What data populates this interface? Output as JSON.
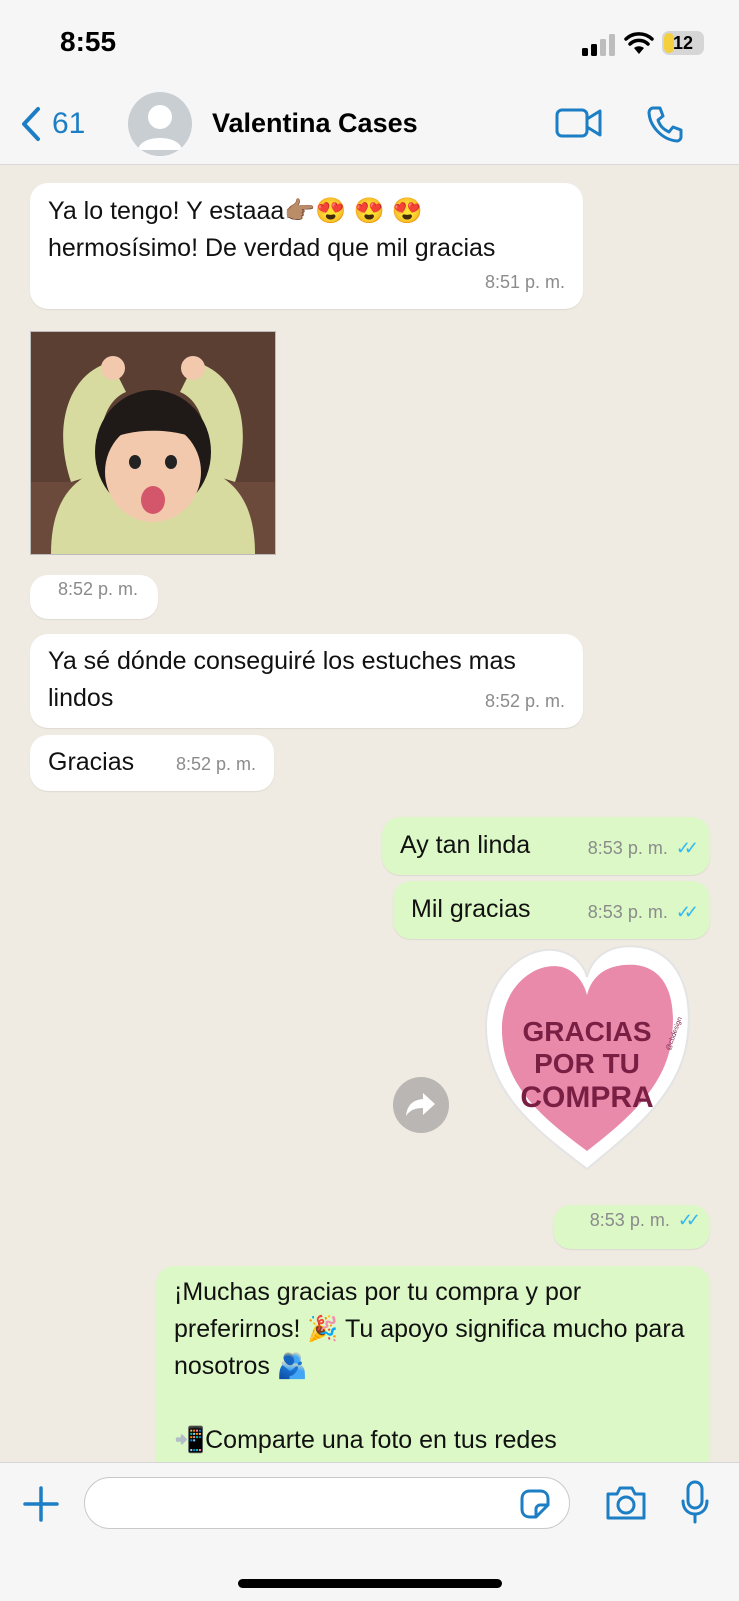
{
  "status_bar": {
    "time": "8:55",
    "battery": "12"
  },
  "header": {
    "back_count": "61",
    "contact_name": "Valentina Cases"
  },
  "messages": [
    {
      "direction": "in",
      "text": "Ya lo tengo! Y estaaa👉🏽😍 😍 😍 hermosísimo! De verdad que mil gracias",
      "time": "8:51 p. m."
    },
    {
      "direction": "in",
      "type": "image",
      "time": "8:52 p. m."
    },
    {
      "direction": "in",
      "text": "Ya sé dónde conseguiré los estuches mas lindos",
      "time": "8:52 p. m."
    },
    {
      "direction": "in",
      "text": "Gracias",
      "time": "8:52 p. m."
    },
    {
      "direction": "out",
      "text": "Ay tan linda",
      "time": "8:53 p. m."
    },
    {
      "direction": "out",
      "text": "Mil gracias",
      "time": "8:53 p. m."
    },
    {
      "direction": "out",
      "type": "sticker",
      "sticker_text": "GRACIAS POR TU COMPRA",
      "sticker_credit": "@cbdesign",
      "time": "8:53 p. m."
    },
    {
      "direction": "out",
      "text_lines": [
        "¡Muchas gracias por tu compra y por preferirnos! 🎉 Tu apoyo significa mucho para nosotros 🫂",
        "📲Comparte una foto en tus redes"
      ]
    }
  ],
  "colors": {
    "incoming_bubble": "#ffffff",
    "outgoing_bubble": "#dcf8c6",
    "accent": "#1c7ec4",
    "read_ticks": "#34b7f1",
    "chat_background": "#efeae2"
  },
  "icons": [
    "back-chevron-icon",
    "video-call-icon",
    "phone-icon",
    "forward-icon",
    "plus-icon",
    "sticker-icon",
    "camera-icon",
    "microphone-icon",
    "double-check-icon"
  ]
}
